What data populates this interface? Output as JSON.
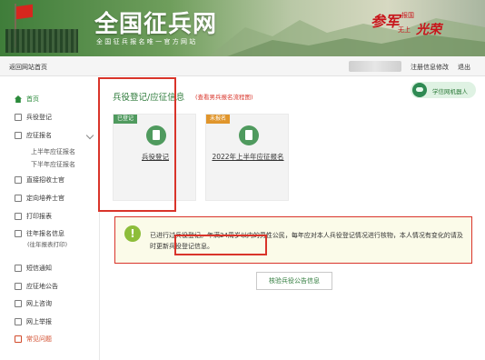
{
  "header": {
    "site_title": "全国征兵网",
    "site_subtitle": "全国征兵报名唯一官方网站",
    "slogan": {
      "part1": "参军",
      "part2": "报国",
      "part3": "无上",
      "part4": "光荣"
    }
  },
  "topnav": {
    "home_link": "返回网站首页",
    "modify_info": "注册信息修改",
    "logout": "退出"
  },
  "sidebar": {
    "items": [
      {
        "label": "首页"
      },
      {
        "label": "兵役登记"
      },
      {
        "label": "应征报名"
      },
      {
        "label": "上半年应征报名"
      },
      {
        "label": "下半年应征报名"
      },
      {
        "label": "直接招收士官"
      },
      {
        "label": "定向培养士官"
      },
      {
        "label": "打印报表"
      },
      {
        "label": "往年报名信息"
      },
      {
        "label": "(往年报表打印)"
      },
      {
        "label": "短信通知"
      },
      {
        "label": "应征地公告"
      },
      {
        "label": "网上咨询"
      },
      {
        "label": "网上举报"
      },
      {
        "label": "常见问题"
      }
    ]
  },
  "main": {
    "title": "兵役登记/应征信息",
    "flow_link": "(查看男兵报名流程图)",
    "robot_label": "学信网机器人",
    "cards": [
      {
        "tag": "已登记",
        "tag_color": "#4f9a5e",
        "caption": "兵役登记"
      },
      {
        "tag": "未报名",
        "tag_color": "#e0952b",
        "caption": "2022年上半年应征报名"
      }
    ],
    "notice": "已进行过兵役登记。年满24周岁以内的男性公民，每年应对本人兵役登记情况进行核物，本人情况有变化的请及时更新兵役登记信息。",
    "query_button": "核验兵役公告信息"
  },
  "colors": {
    "accent_green": "#2d7a3a",
    "annotation_red": "#d9342a"
  }
}
